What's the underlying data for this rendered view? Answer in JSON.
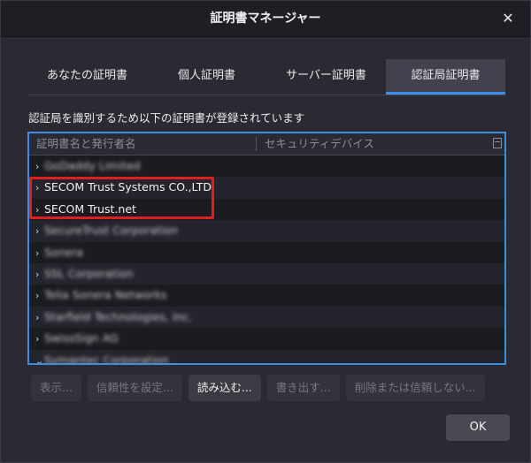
{
  "window": {
    "title": "証明書マネージャー",
    "close_glyph": "✕"
  },
  "tabs": [
    {
      "label": "あなたの証明書",
      "active": false
    },
    {
      "label": "個人証明書",
      "active": false
    },
    {
      "label": "サーバー証明書",
      "active": false
    },
    {
      "label": "認証局証明書",
      "active": true
    }
  ],
  "description": "認証局を識別するため以下の証明書が登録されています",
  "tree": {
    "columns": [
      "証明書名と発行者名",
      "セキュリティデバイス"
    ],
    "rows": [
      {
        "label": "GoDaddy Limited",
        "blurred": true,
        "expanded": false
      },
      {
        "label": "SECOM Trust Systems CO.,LTD.",
        "blurred": false,
        "expanded": false
      },
      {
        "label": "SECOM Trust.net",
        "blurred": false,
        "expanded": false
      },
      {
        "label": "SecureTrust Corporation",
        "blurred": true,
        "expanded": false
      },
      {
        "label": "Sonera",
        "blurred": true,
        "expanded": false
      },
      {
        "label": "SSL Corporation",
        "blurred": true,
        "expanded": false
      },
      {
        "label": "Telia Sonera Networks",
        "blurred": true,
        "expanded": false
      },
      {
        "label": "Starfield Technologies, Inc.",
        "blurred": true,
        "expanded": false
      },
      {
        "label": "SwissSign AG",
        "blurred": true,
        "expanded": false
      },
      {
        "label": "Symantec Corporation",
        "blurred": true,
        "expanded": true
      }
    ]
  },
  "buttons": [
    {
      "label": "表示...",
      "enabled": false
    },
    {
      "label": "信頼性を設定...",
      "enabled": false
    },
    {
      "label": "読み込む...",
      "enabled": true
    },
    {
      "label": "書き出す...",
      "enabled": false
    },
    {
      "label": "削除または信頼しない...",
      "enabled": false
    }
  ],
  "ok_label": "OK",
  "colors": {
    "accent": "#3a8ee6",
    "highlight_border": "#e01e1e"
  }
}
